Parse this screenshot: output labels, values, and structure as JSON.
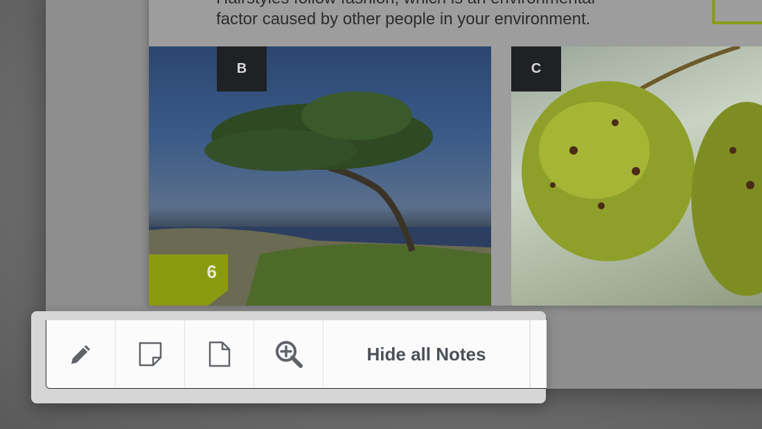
{
  "document": {
    "text_line_1": "Hairstyles follow fashion, which is an environmental",
    "text_line_2": "factor caused by other people in your environment.",
    "photo_b_label": "B",
    "photo_c_label": "C",
    "page_number": "6"
  },
  "toolbar": {
    "buttons": [
      {
        "icon": "pencil-icon"
      },
      {
        "icon": "sticky-note-icon"
      },
      {
        "icon": "page-icon"
      },
      {
        "icon": "zoom-in-icon"
      }
    ],
    "hide_notes_label": "Hide all Notes"
  },
  "colors": {
    "accent_green": "#8c9a12",
    "badge_dark": "#1f2125",
    "toolbar_bg": "#fbfbfb",
    "icon_gray": "#5f6368"
  }
}
